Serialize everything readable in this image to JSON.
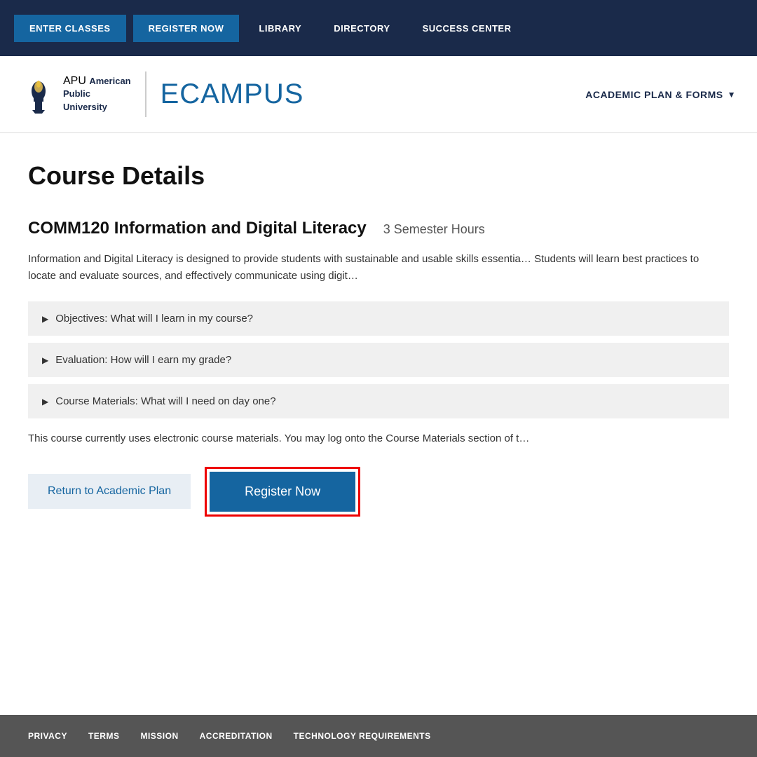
{
  "topnav": {
    "btn_enter": "ENTER CLASSES",
    "btn_register": "REGISTER NOW",
    "link_library": "LIBRARY",
    "link_directory": "DIRECTORY",
    "link_success": "SUCCESS CENTER"
  },
  "logobar": {
    "apu_abbr": "APU",
    "apu_name_line1": "American",
    "apu_name_line2": "Public",
    "apu_name_line3": "University",
    "ecampus": "ECAMPUS",
    "academic_plan": "ACADEMIC PLAN & FORMS"
  },
  "main": {
    "page_title": "Course Details",
    "course_code": "COMM120 Information and Digital Literacy",
    "semester_hours": "3 Semester Hours",
    "description": "Information and Digital Literacy is designed to provide students with sustainable and usable skills essentia… Students will learn best practices to locate and evaluate sources, and effectively communicate using digit…",
    "accordion": [
      {
        "label": "Objectives: What will I learn in my course?"
      },
      {
        "label": "Evaluation: How will I earn my grade?"
      },
      {
        "label": "Course Materials: What will I need on day one?"
      }
    ],
    "course_materials_note": "This course currently uses electronic course materials. You may log onto the Course Materials section of t…",
    "btn_return": "Return to Academic Plan",
    "btn_register": "Register Now"
  },
  "footer": {
    "links": [
      "PRIVACY",
      "TERMS",
      "MISSION",
      "ACCREDITATION",
      "TECHNOLOGY REQUIREMENTS"
    ]
  }
}
